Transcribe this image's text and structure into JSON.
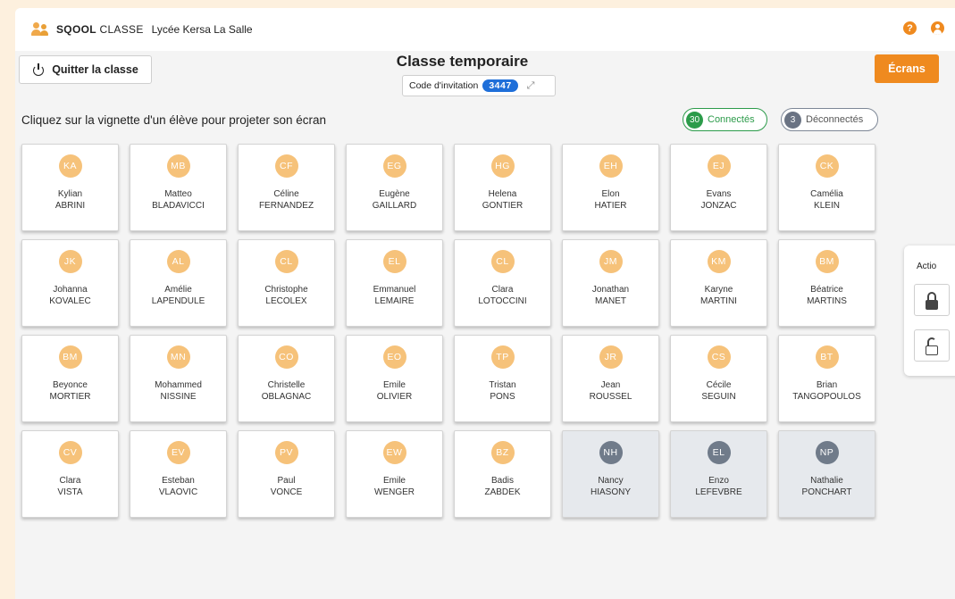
{
  "header": {
    "brand_bold": "SQOOL",
    "brand_light": "CLASSE",
    "school": "Lycée Kersa La Salle",
    "help_icon": "question-circle-icon",
    "user_icon": "user-circle-icon"
  },
  "toolbar": {
    "quit_label": "Quitter la classe",
    "class_title": "Classe temporaire",
    "invite_label": "Code d'invitation",
    "invite_code": "3447",
    "screens_label": "Écrans"
  },
  "instruction": "Cliquez sur la vignette d'un élève pour projeter son écran",
  "filters": {
    "connected_count": "30",
    "connected_label": "Connectés",
    "disconnected_count": "3",
    "disconnected_label": "Déconnectés"
  },
  "students": [
    {
      "initials": "KA",
      "first": "Kylian",
      "last": "ABRINI",
      "connected": true
    },
    {
      "initials": "MB",
      "first": "Matteo",
      "last": "BLADAVICCI",
      "connected": true
    },
    {
      "initials": "CF",
      "first": "Céline",
      "last": "FERNANDEZ",
      "connected": true
    },
    {
      "initials": "EG",
      "first": "Eugène",
      "last": "GAILLARD",
      "connected": true
    },
    {
      "initials": "HG",
      "first": "Helena",
      "last": "GONTIER",
      "connected": true
    },
    {
      "initials": "EH",
      "first": "Elon",
      "last": "HATIER",
      "connected": true
    },
    {
      "initials": "EJ",
      "first": "Evans",
      "last": "JONZAC",
      "connected": true
    },
    {
      "initials": "CK",
      "first": "Camélia",
      "last": "KLEIN",
      "connected": true
    },
    {
      "initials": "JK",
      "first": "Johanna",
      "last": "KOVALEC",
      "connected": true
    },
    {
      "initials": "AL",
      "first": "Amélie",
      "last": "LAPENDULE",
      "connected": true
    },
    {
      "initials": "CL",
      "first": "Christophe",
      "last": "LECOLEX",
      "connected": true
    },
    {
      "initials": "EL",
      "first": "Emmanuel",
      "last": "LEMAIRE",
      "connected": true
    },
    {
      "initials": "CL",
      "first": "Clara",
      "last": "LOTOCCINI",
      "connected": true
    },
    {
      "initials": "JM",
      "first": "Jonathan",
      "last": "MANET",
      "connected": true
    },
    {
      "initials": "KM",
      "first": "Karyne",
      "last": "MARTINI",
      "connected": true
    },
    {
      "initials": "BM",
      "first": "Béatrice",
      "last": "MARTINS",
      "connected": true
    },
    {
      "initials": "BM",
      "first": "Beyonce",
      "last": "MORTIER",
      "connected": true
    },
    {
      "initials": "MN",
      "first": "Mohammed",
      "last": "NISSINE",
      "connected": true
    },
    {
      "initials": "CO",
      "first": "Christelle",
      "last": "OBLAGNAC",
      "connected": true
    },
    {
      "initials": "EO",
      "first": "Emile",
      "last": "OLIVIER",
      "connected": true
    },
    {
      "initials": "TP",
      "first": "Tristan",
      "last": "PONS",
      "connected": true
    },
    {
      "initials": "JR",
      "first": "Jean",
      "last": "ROUSSEL",
      "connected": true
    },
    {
      "initials": "CS",
      "first": "Cécile",
      "last": "SEGUIN",
      "connected": true
    },
    {
      "initials": "BT",
      "first": "Brian",
      "last": "TANGOPOULOS",
      "connected": true
    },
    {
      "initials": "CV",
      "first": "Clara",
      "last": "VISTA",
      "connected": true
    },
    {
      "initials": "EV",
      "first": "Esteban",
      "last": "VLAOVIC",
      "connected": true
    },
    {
      "initials": "PV",
      "first": "Paul",
      "last": "VONCE",
      "connected": true
    },
    {
      "initials": "EW",
      "first": "Emile",
      "last": "WENGER",
      "connected": true
    },
    {
      "initials": "BZ",
      "first": "Badis",
      "last": "ZABDEK",
      "connected": true
    },
    {
      "initials": "NH",
      "first": "Nancy",
      "last": "HIASONY",
      "connected": false
    },
    {
      "initials": "EL",
      "first": "Enzo",
      "last": "LEFEVBRE",
      "connected": false
    },
    {
      "initials": "NP",
      "first": "Nathalie",
      "last": "PONCHART",
      "connected": false
    }
  ],
  "actions": {
    "label": "Actio",
    "lock_icon": "lock-icon",
    "unlock_icon": "unlock-icon"
  },
  "colors": {
    "accent": "#ef8a1f",
    "connected": "#2c9b4a",
    "disconnected": "#6a7383",
    "avatar": "#f6c27a",
    "invite_badge": "#1f6fd9"
  }
}
